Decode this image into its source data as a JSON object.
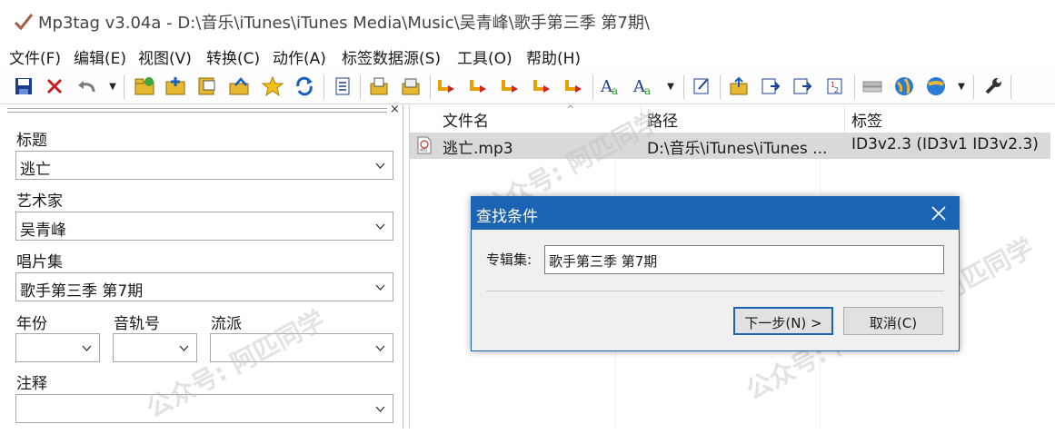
{
  "window": {
    "title": "Mp3tag v3.04a  -  D:\\音乐\\iTunes\\iTunes Media\\Music\\吴青峰\\歌手第三季 第7期\\"
  },
  "menu": [
    "文件(F)",
    "编辑(E)",
    "视图(V)",
    "转换(C)",
    "动作(A)",
    "标签数据源(S)",
    "工具(O)",
    "帮助(H)"
  ],
  "tag_panel": {
    "title_label": "标题",
    "title_value": "逃亡",
    "artist_label": "艺术家",
    "artist_value": "吴青峰",
    "album_label": "唱片集",
    "album_value": "歌手第三季 第7期",
    "year_label": "年份",
    "year_value": "",
    "track_label": "音轨号",
    "track_value": "",
    "genre_label": "流派",
    "genre_value": "",
    "comment_label": "注释",
    "comment_value": ""
  },
  "file_list": {
    "columns": [
      "文件名",
      "路径",
      "标签"
    ],
    "rows": [
      {
        "filename": "逃亡.mp3",
        "path": "D:\\音乐\\iTunes\\iTunes ...",
        "tag": "ID3v2.3 (ID3v1 ID3v2.3)"
      }
    ]
  },
  "dialog": {
    "title": "查找条件",
    "field_label": "专辑集:",
    "field_value": "歌手第三季 第7期",
    "next_button": "下一步(N) >",
    "cancel_button": "取消(C)"
  },
  "watermark_text": "公众号: 阿匹同学",
  "colors": {
    "accent": "#1b63b3",
    "selected_row": "#d9d9d9"
  }
}
